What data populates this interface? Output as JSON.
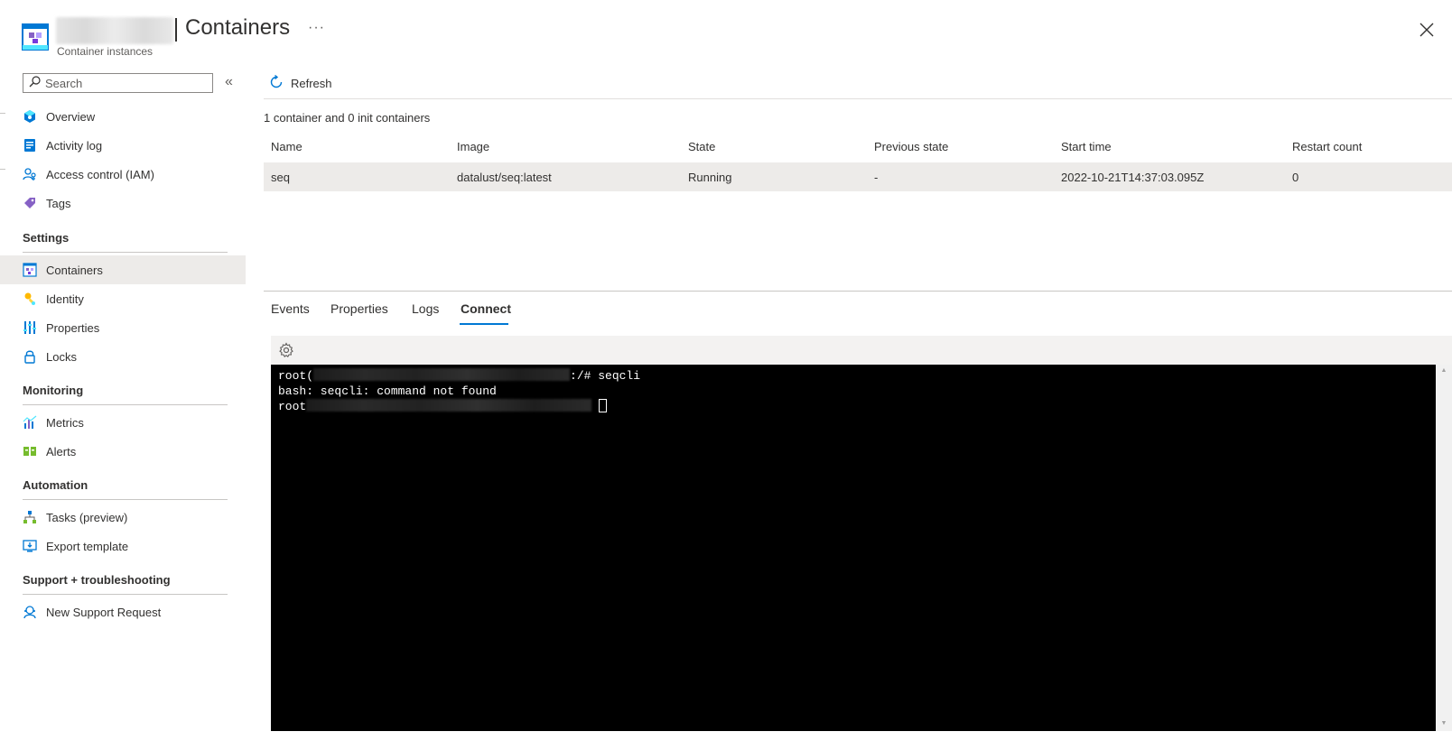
{
  "header": {
    "title": "Containers",
    "subtitle": "Container instances",
    "more_label": "···",
    "close_label": "Close"
  },
  "sidebar": {
    "search_placeholder": "Search",
    "collapse_label": "«",
    "top_items": [
      {
        "label": "Overview",
        "icon": "overview-icon"
      },
      {
        "label": "Activity log",
        "icon": "activity-log-icon"
      },
      {
        "label": "Access control (IAM)",
        "icon": "iam-icon"
      },
      {
        "label": "Tags",
        "icon": "tag-icon"
      }
    ],
    "groups": [
      {
        "title": "Settings",
        "items": [
          {
            "label": "Containers",
            "icon": "containers-icon",
            "active": true
          },
          {
            "label": "Identity",
            "icon": "identity-icon"
          },
          {
            "label": "Properties",
            "icon": "properties-icon"
          },
          {
            "label": "Locks",
            "icon": "lock-icon"
          }
        ]
      },
      {
        "title": "Monitoring",
        "items": [
          {
            "label": "Metrics",
            "icon": "metrics-icon"
          },
          {
            "label": "Alerts",
            "icon": "alerts-icon"
          }
        ]
      },
      {
        "title": "Automation",
        "items": [
          {
            "label": "Tasks (preview)",
            "icon": "tasks-icon"
          },
          {
            "label": "Export template",
            "icon": "export-template-icon"
          }
        ]
      },
      {
        "title": "Support + troubleshooting",
        "items": [
          {
            "label": "New Support Request",
            "icon": "support-icon"
          }
        ]
      }
    ]
  },
  "toolbar": {
    "refresh_label": "Refresh"
  },
  "summary": "1 container and 0 init containers",
  "table": {
    "columns": [
      "Name",
      "Image",
      "State",
      "Previous state",
      "Start time",
      "Restart count"
    ],
    "rows": [
      [
        "seq",
        "datalust/seq:latest",
        "Running",
        "-",
        "2022-10-21T14:37:03.095Z",
        "0"
      ]
    ]
  },
  "tabs": [
    {
      "label": "Events",
      "active": false
    },
    {
      "label": "Properties",
      "active": false
    },
    {
      "label": "Logs",
      "active": false
    },
    {
      "label": "Connect",
      "active": true
    }
  ],
  "terminal": {
    "line1_prefix": "root(",
    "line1_suffix": ":/# seqcli",
    "line2": "bash: seqcli: command not found",
    "line3_prefix": "root"
  },
  "colors": {
    "accent": "#0078d4",
    "active_bg": "#edebe9",
    "terminal_bg": "#000000"
  }
}
